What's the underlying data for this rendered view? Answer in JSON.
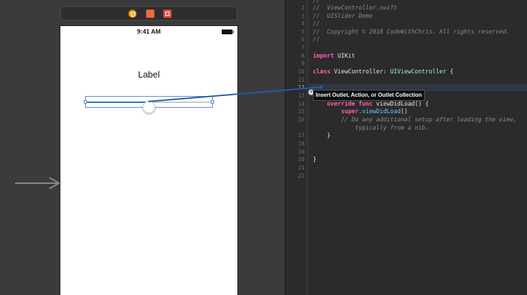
{
  "storyboard": {
    "status_time": "9:41 AM",
    "label_text": "Label",
    "slider_value": 0.5,
    "dock_icons": [
      "view-controller-icon",
      "first-responder-icon",
      "exit-icon"
    ]
  },
  "editor": {
    "lines": [
      {
        "num": "",
        "text": "//",
        "kind": "cm"
      },
      {
        "num": "2",
        "text": "//  ViewController.swift",
        "kind": "cm"
      },
      {
        "num": "3",
        "text": "//  UISlider Demo",
        "kind": "cm"
      },
      {
        "num": "4",
        "text": "//",
        "kind": "cm"
      },
      {
        "num": "5",
        "text": "//  Copyright © 2018 CodeWithChris. All rights reserved.",
        "kind": "cm"
      },
      {
        "num": "6",
        "text": "//",
        "kind": "cm"
      },
      {
        "num": "7",
        "text": "",
        "kind": "blank"
      },
      {
        "num": "8",
        "text": "import UIKit",
        "kind": "import"
      },
      {
        "num": "9",
        "text": "",
        "kind": "blank"
      },
      {
        "num": "10",
        "text": "class ViewController: UIViewController {",
        "kind": "class"
      },
      {
        "num": "11",
        "text": "",
        "kind": "blank"
      },
      {
        "num": "12",
        "text": "",
        "kind": "blank"
      },
      {
        "num": "13",
        "text": "",
        "kind": "blank"
      },
      {
        "num": "14",
        "text": "    override func viewDidLoad() {",
        "kind": "func"
      },
      {
        "num": "15",
        "text": "        super.viewDidLoad()",
        "kind": "super"
      },
      {
        "num": "16",
        "text": "        // Do any additional setup after loading the view,",
        "kind": "cm"
      },
      {
        "num": "",
        "text": "            typically from a nib.",
        "kind": "cm"
      },
      {
        "num": "17",
        "text": "    }",
        "kind": "plain"
      },
      {
        "num": "18",
        "text": "",
        "kind": "blank"
      },
      {
        "num": "19",
        "text": "",
        "kind": "blank"
      },
      {
        "num": "20",
        "text": "}",
        "kind": "plain"
      },
      {
        "num": "21",
        "text": "",
        "kind": "blank"
      },
      {
        "num": "22",
        "text": "",
        "kind": "blank"
      }
    ],
    "active_line": "12",
    "tooltip": "Insert Outlet, Action, or Outlet Collection"
  }
}
